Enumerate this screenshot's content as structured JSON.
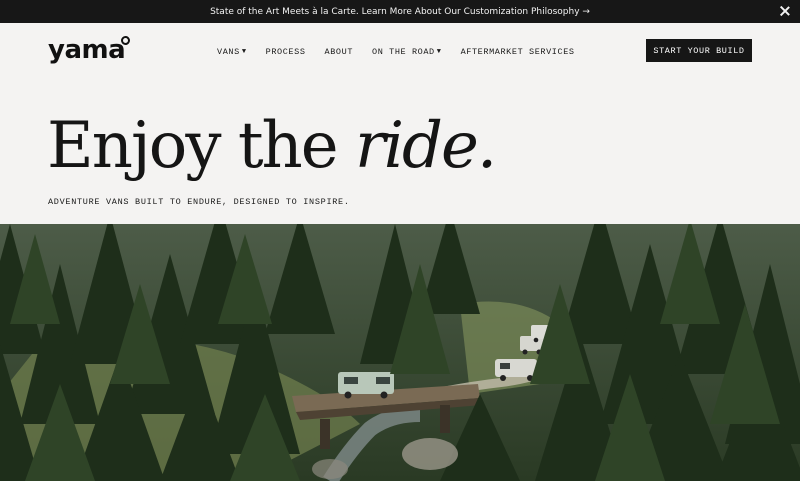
{
  "announcement": {
    "text": "State of the Art Meets à la Carte. Learn More About Our Customization Philosophy →",
    "close_icon": "close-icon"
  },
  "brand": {
    "name": "yama"
  },
  "nav": {
    "items": [
      {
        "label": "VANS",
        "caret": "▼"
      },
      {
        "label": "PROCESS"
      },
      {
        "label": "ABOUT"
      },
      {
        "label": "ON THE ROAD",
        "caret": "▼"
      },
      {
        "label": "AFTERMARKET SERVICES"
      }
    ],
    "cta_label": "START YOUR BUILD"
  },
  "hero": {
    "title_main": "Enjoy the ",
    "title_accent": "ride.",
    "tagline": "ADVENTURE VANS BUILT TO ENDURE, DESIGNED TO INSPIRE."
  },
  "colors": {
    "background": "#f4f3f2",
    "announcement_bar": "#171717",
    "cta": "#161616",
    "forest": "#2c3a25"
  }
}
